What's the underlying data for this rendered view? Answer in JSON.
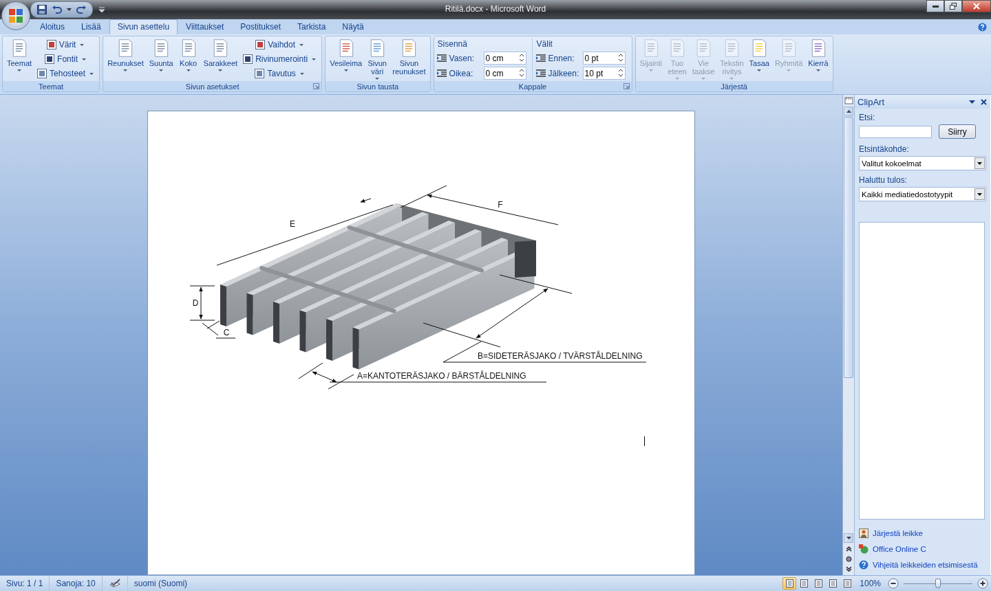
{
  "window": {
    "title": "Ritilä.docx - Microsoft Word"
  },
  "tabs": [
    {
      "label": "Aloitus",
      "selected": false
    },
    {
      "label": "Lisää",
      "selected": false
    },
    {
      "label": "Sivun asettelu",
      "selected": true
    },
    {
      "label": "Viittaukset",
      "selected": false
    },
    {
      "label": "Postitukset",
      "selected": false
    },
    {
      "label": "Tarkista",
      "selected": false
    },
    {
      "label": "Näytä",
      "selected": false
    }
  ],
  "ribbon": {
    "groups": [
      {
        "title": "Teemat",
        "launcher": false,
        "columns": [
          {
            "items": [
              {
                "kind": "large",
                "label": "Teemat",
                "dropdown": true,
                "disabled": false
              }
            ]
          },
          {
            "items": [
              {
                "kind": "small",
                "label": "Värit",
                "dropdown": true,
                "disabled": false
              },
              {
                "kind": "small",
                "label": "Fontit",
                "dropdown": true,
                "disabled": false
              },
              {
                "kind": "small",
                "label": "Tehosteet",
                "dropdown": true,
                "disabled": false
              }
            ]
          }
        ]
      },
      {
        "title": "Sivun asetukset",
        "launcher": true,
        "columns": [
          {
            "items": [
              {
                "kind": "large",
                "label": "Reunukset",
                "dropdown": true,
                "disabled": false
              }
            ]
          },
          {
            "items": [
              {
                "kind": "large",
                "label": "Suunta",
                "dropdown": true,
                "disabled": false
              }
            ]
          },
          {
            "items": [
              {
                "kind": "large",
                "label": "Koko",
                "dropdown": true,
                "disabled": false
              }
            ]
          },
          {
            "items": [
              {
                "kind": "large",
                "label": "Sarakkeet",
                "dropdown": true,
                "disabled": false
              }
            ]
          },
          {
            "items": [
              {
                "kind": "small",
                "label": "Vaihdot",
                "dropdown": true,
                "disabled": false
              },
              {
                "kind": "small",
                "label": "Rivinumerointi",
                "dropdown": true,
                "disabled": false
              },
              {
                "kind": "small",
                "label": "Tavutus",
                "dropdown": true,
                "disabled": false
              }
            ]
          }
        ]
      },
      {
        "title": "Sivun tausta",
        "launcher": false,
        "columns": [
          {
            "items": [
              {
                "kind": "large",
                "label": "Vesileima",
                "dropdown": true,
                "disabled": false
              }
            ]
          },
          {
            "items": [
              {
                "kind": "large",
                "label": "Sivun väri",
                "dropdown": true,
                "disabled": false
              }
            ]
          },
          {
            "items": [
              {
                "kind": "large",
                "label": "Sivun reunukset",
                "dropdown": false,
                "disabled": false
              }
            ]
          }
        ]
      },
      {
        "title": "Kappale",
        "launcher": true,
        "columns": [
          {
            "heading": "Sisennä",
            "items": [
              {
                "kind": "spin",
                "label": "Vasen:",
                "value": "0 cm",
                "disabled": false
              },
              {
                "kind": "spin",
                "label": "Oikea:",
                "value": "0 cm",
                "disabled": false
              }
            ]
          },
          {
            "heading": "Välit",
            "items": [
              {
                "kind": "spin",
                "label": "Ennen:",
                "value": "0 pt",
                "disabled": false
              },
              {
                "kind": "spin",
                "label": "Jälkeen:",
                "value": "10 pt",
                "disabled": false
              }
            ]
          }
        ]
      },
      {
        "title": "Järjestä",
        "launcher": false,
        "columns": [
          {
            "items": [
              {
                "kind": "large",
                "label": "Sijainti",
                "dropdown": true,
                "disabled": true
              }
            ]
          },
          {
            "items": [
              {
                "kind": "large",
                "label": "Tuo eteen",
                "dropdown": true,
                "disabled": true
              }
            ]
          },
          {
            "items": [
              {
                "kind": "large",
                "label": "Vie taakse",
                "dropdown": true,
                "disabled": true
              }
            ]
          },
          {
            "items": [
              {
                "kind": "large",
                "label": "Tekstin rivitys",
                "dropdown": true,
                "disabled": true
              }
            ]
          },
          {
            "items": [
              {
                "kind": "large",
                "label": "Tasaa",
                "dropdown": true,
                "disabled": false
              }
            ]
          },
          {
            "items": [
              {
                "kind": "large",
                "label": "Ryhmitä",
                "dropdown": true,
                "disabled": true
              }
            ]
          },
          {
            "items": [
              {
                "kind": "large",
                "label": "Kierrä",
                "dropdown": true,
                "disabled": false
              }
            ]
          }
        ]
      }
    ]
  },
  "document": {
    "figure": {
      "labels": [
        "E",
        "F",
        "D",
        "C",
        "B=SIDETERÄSJAKO / TVÄRSTÅLDELNING",
        "A=KANTOTERÄSJAKO / BÄRSTÅLDELNING"
      ]
    }
  },
  "clipart_pane": {
    "title": "ClipArt",
    "search_label": "Etsi:",
    "go_button": "Siirry",
    "fields": [
      {
        "label": "Etsintäkohde:",
        "value": "Valitut kokoelmat"
      },
      {
        "label": "Haluttu tulos:",
        "value": "Kaikki mediatiedostotyypit"
      }
    ],
    "links": [
      "Järjestä leikke",
      "Office Online C",
      "Vihjeitä leikkeiden etsimisestä"
    ]
  },
  "status_bar": {
    "page": "Sivu: 1 / 1",
    "words": "Sanoja: 10",
    "language": "suomi (Suomi)",
    "views": [
      {
        "selected": true
      },
      {
        "selected": false
      },
      {
        "selected": false
      },
      {
        "selected": false
      },
      {
        "selected": false
      }
    ],
    "zoom": "100%",
    "zoom_slider": {
      "level": 0.5
    }
  }
}
